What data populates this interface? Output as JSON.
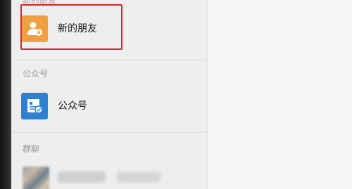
{
  "contacts": {
    "sections": {
      "top_header": "新的朋友",
      "official_header": "公众号",
      "groups_header": "群聊"
    },
    "items": {
      "new_friends": "新的朋友",
      "official_accounts": "公众号"
    }
  },
  "colors": {
    "new_friends_avatar": "#f0a040",
    "official_avatar": "#2f7fd3",
    "highlight_box": "#d9262b"
  },
  "icons": {
    "new_friends": "add-person-icon",
    "official_accounts": "official-account-icon"
  }
}
